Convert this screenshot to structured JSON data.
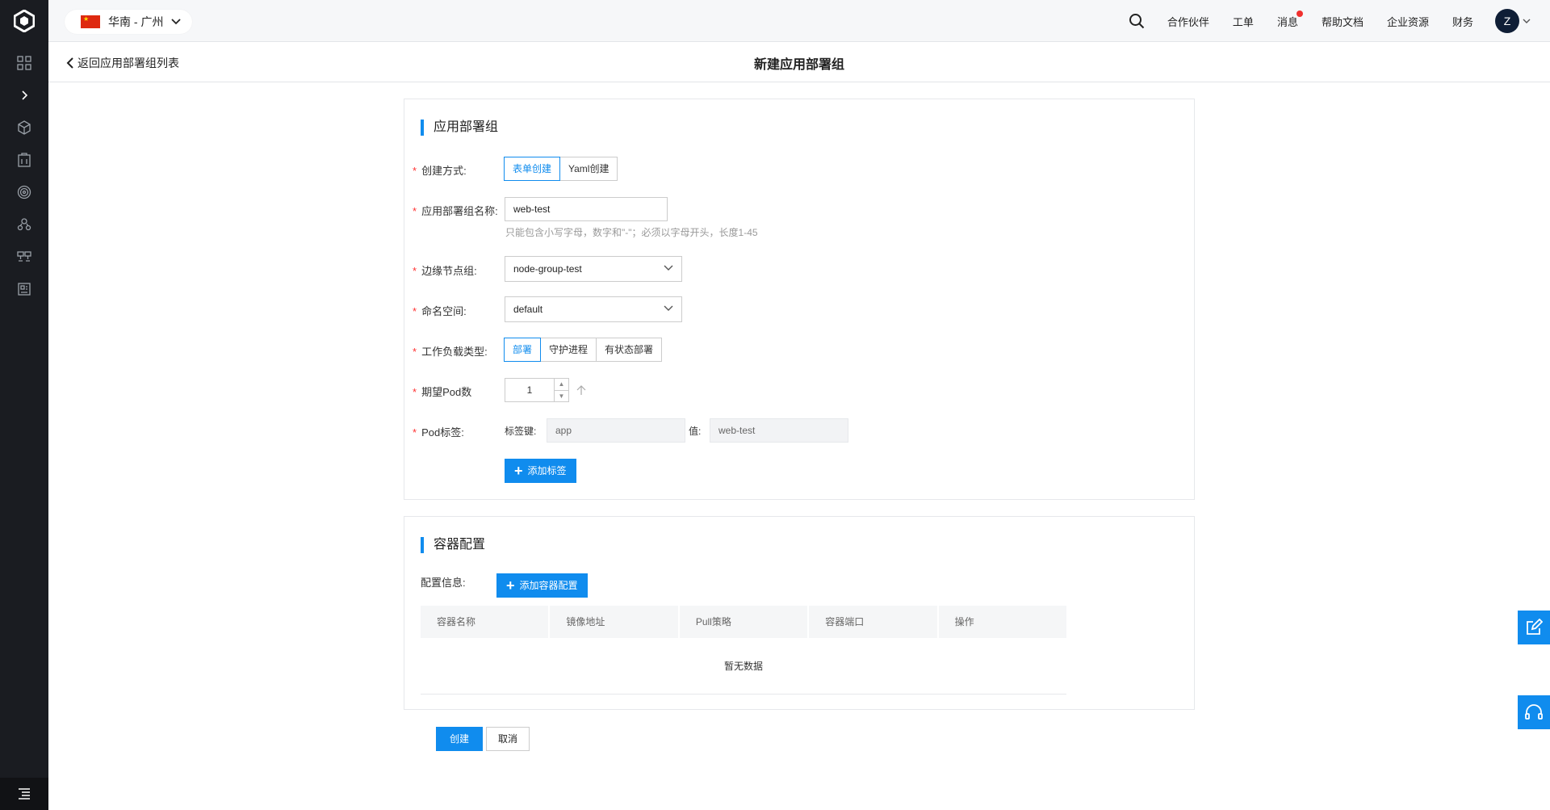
{
  "topbar": {
    "region": "华南 - 广州",
    "nav": [
      "合作伙伴",
      "工单",
      "消息",
      "帮助文档",
      "企业资源",
      "财务"
    ],
    "avatar_letter": "Z"
  },
  "subheader": {
    "back_label": "返回应用部署组列表",
    "title": "新建应用部署组"
  },
  "section1": {
    "title": "应用部署组",
    "create_mode": {
      "label": "创建方式:",
      "options": [
        "表单创建",
        "Yaml创建"
      ],
      "selected": "表单创建"
    },
    "name": {
      "label": "应用部署组名称:",
      "value": "web-test",
      "hint": "只能包含小写字母，数字和\"-\"；必须以字母开头，长度1-45"
    },
    "node_group": {
      "label": "边缘节点组:",
      "value": "node-group-test"
    },
    "namespace": {
      "label": "命名空间:",
      "value": "default"
    },
    "workload": {
      "label": "工作负载类型:",
      "options": [
        "部署",
        "守护进程",
        "有状态部署"
      ],
      "selected": "部署"
    },
    "pod_count": {
      "label": "期望Pod数",
      "value": "1"
    },
    "pod_labels": {
      "label": "Pod标签:",
      "key_label": "标签键:",
      "key_value": "app",
      "val_label": "值:",
      "val_value": "web-test"
    },
    "add_label_button": "添加标签"
  },
  "section2": {
    "title": "容器配置",
    "config_label": "配置信息:",
    "add_container_button": "添加容器配置",
    "columns": [
      "容器名称",
      "镜像地址",
      "Pull策略",
      "容器端口",
      "操作"
    ],
    "empty_text": "暂无数据"
  },
  "footer": {
    "create_button": "创建",
    "cancel_button": "取消"
  },
  "colors": {
    "primary": "#108cee",
    "sidebar": "#1a1c21",
    "required": "#ff3333"
  }
}
